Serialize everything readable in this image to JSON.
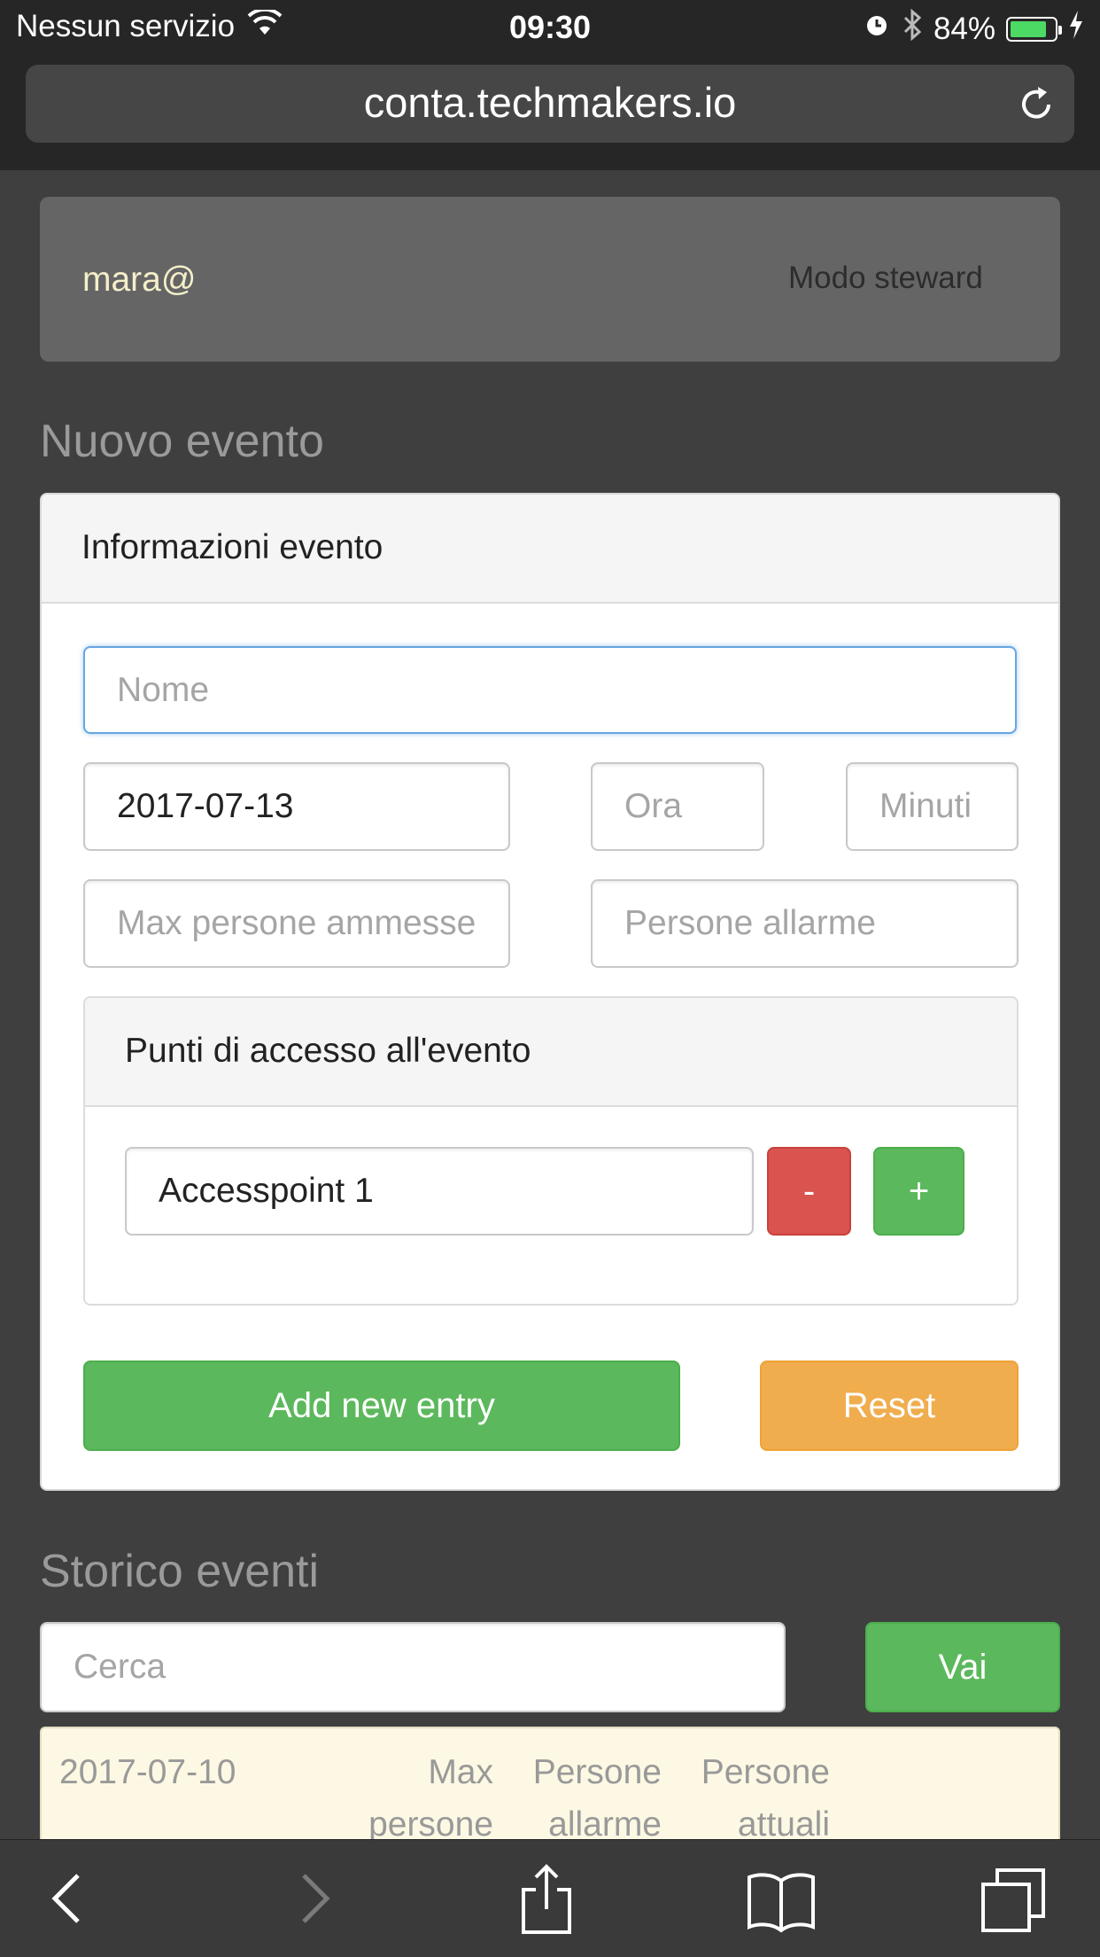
{
  "status": {
    "carrier": "Nessun servizio",
    "time": "09:30",
    "battery_percent": "84%",
    "battery_level": 0.84,
    "battery_color": "#4cd964"
  },
  "browser": {
    "url": "conta.techmakers.io"
  },
  "user_panel": {
    "username": "mara@",
    "mode_link": "Modo steward"
  },
  "new_event": {
    "section_title": "Nuovo evento",
    "card_title": "Informazioni evento",
    "name_placeholder": "Nome",
    "date_value": "2017-07-13",
    "hour_placeholder": "Ora",
    "minute_placeholder": "Minuti",
    "max_people_placeholder": "Max persone ammesse",
    "alarm_people_placeholder": "Persone allarme",
    "access_points": {
      "title": "Punti di accesso all'evento",
      "entries": [
        {
          "value": "Accesspoint 1"
        }
      ],
      "remove_label": "-",
      "add_label": "+"
    },
    "add_button": "Add new entry",
    "reset_button": "Reset"
  },
  "history": {
    "section_title": "Storico eventi",
    "search_placeholder": "Cerca",
    "go_button": "Vai",
    "row": {
      "date": "2017-07-10",
      "col1_line1": "Max",
      "col1_line2": "persone",
      "col2_line1": "Persone",
      "col2_line2": "allarme",
      "col3_line1": "Persone",
      "col3_line2": "attuali"
    }
  },
  "toolbar": {
    "icons": [
      "back-icon",
      "forward-icon",
      "share-icon",
      "bookmarks-icon",
      "tabs-icon"
    ]
  },
  "colors": {
    "success": "#5cb85c",
    "danger": "#d9534f",
    "warning": "#f0ad4e",
    "focus": "#66a6e2"
  }
}
